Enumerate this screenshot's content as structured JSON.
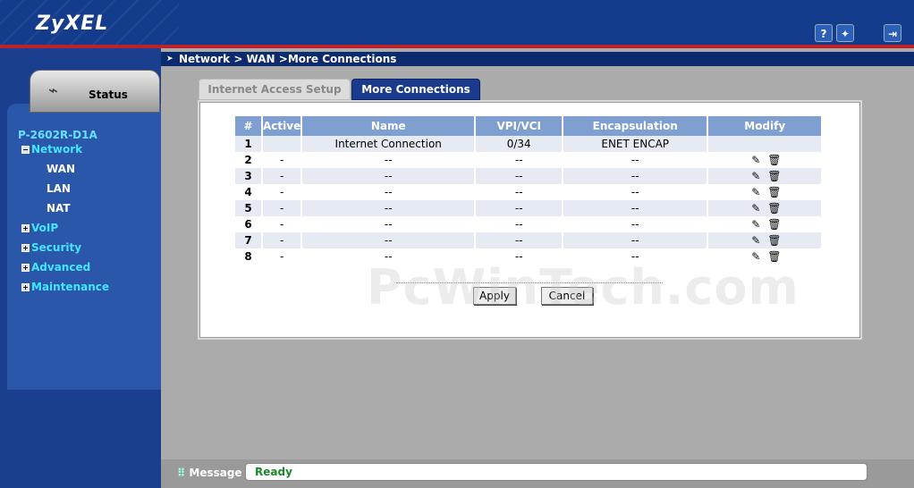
{
  "header": {
    "logo": "ZyXEL",
    "help_icon": "?",
    "wizard_icon": "wizard-icon",
    "logout_icon": "logout-icon"
  },
  "sidebar": {
    "status_label": "Status",
    "model": "P-2602R-D1A",
    "items": [
      {
        "label": "Network",
        "expanded": true
      },
      {
        "label": "WAN"
      },
      {
        "label": "LAN"
      },
      {
        "label": "NAT"
      },
      {
        "label": "VoIP"
      },
      {
        "label": "Security"
      },
      {
        "label": "Advanced"
      },
      {
        "label": "Maintenance"
      }
    ]
  },
  "breadcrumb": "Network > WAN >More Connections",
  "tabs": [
    {
      "label": "Internet Access Setup",
      "active": false
    },
    {
      "label": "More Connections",
      "active": true
    }
  ],
  "table": {
    "headers": [
      "#",
      "Active",
      "Name",
      "VPI/VCI",
      "Encapsulation",
      "Modify"
    ],
    "rows": [
      {
        "num": "1",
        "active": "",
        "name": "Internet Connection",
        "vpi": "0/34",
        "encap": "ENET ENCAP"
      },
      {
        "num": "2",
        "active": "-",
        "name": "--",
        "vpi": "--",
        "encap": "--"
      },
      {
        "num": "3",
        "active": "-",
        "name": "--",
        "vpi": "--",
        "encap": "--"
      },
      {
        "num": "4",
        "active": "-",
        "name": "--",
        "vpi": "--",
        "encap": "--"
      },
      {
        "num": "5",
        "active": "-",
        "name": "--",
        "vpi": "--",
        "encap": "--"
      },
      {
        "num": "6",
        "active": "-",
        "name": "--",
        "vpi": "--",
        "encap": "--"
      },
      {
        "num": "7",
        "active": "-",
        "name": "--",
        "vpi": "--",
        "encap": "--"
      },
      {
        "num": "8",
        "active": "-",
        "name": "--",
        "vpi": "--",
        "encap": "--"
      }
    ]
  },
  "buttons": {
    "apply": "Apply",
    "cancel": "Cancel"
  },
  "watermark": "PcWinTech.com",
  "message": {
    "label": "Message",
    "value": "Ready"
  },
  "colors": {
    "header_bg": "#143c8c",
    "accent_red": "#c0202a",
    "nav_cyan": "#44e6ff",
    "ready_green": "#1a8a2a"
  }
}
